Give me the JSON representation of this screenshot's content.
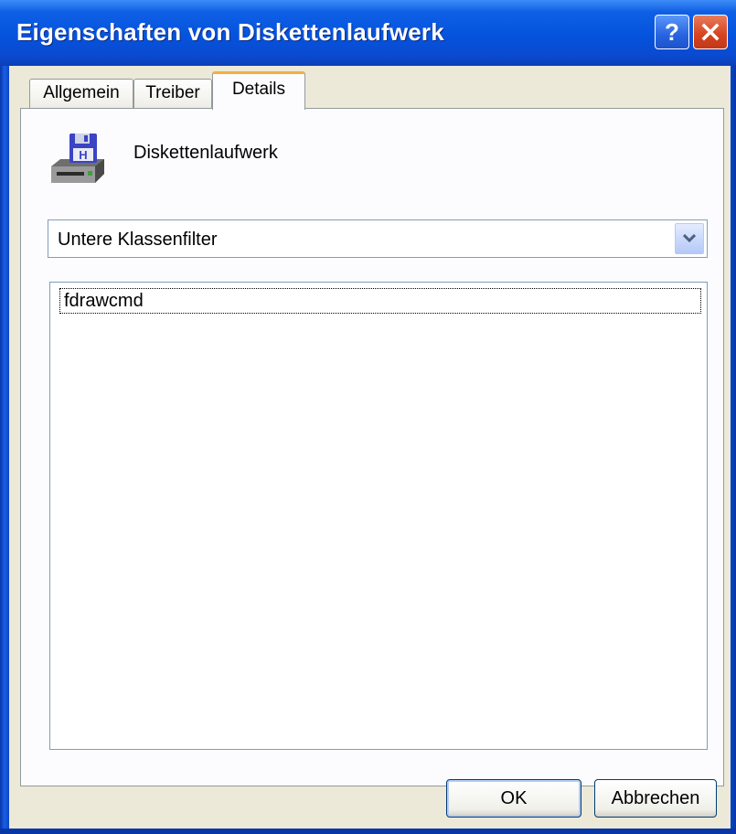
{
  "window": {
    "title": "Eigenschaften von Diskettenlaufwerk"
  },
  "tabs": [
    {
      "label": "Allgemein"
    },
    {
      "label": "Treiber"
    },
    {
      "label": "Details",
      "active": true
    }
  ],
  "device": {
    "icon": "floppy-drive-icon",
    "name": "Diskettenlaufwerk"
  },
  "property_select": {
    "value": "Untere Klassenfilter"
  },
  "values_list": {
    "items": [
      "fdrawcmd"
    ]
  },
  "buttons": {
    "ok": "OK",
    "cancel": "Abbrechen"
  },
  "colors": {
    "titlebar": "#0553dc",
    "dialog_bg": "#ece9d8",
    "active_tab_accent": "#f5ae3f",
    "close_button": "#d6421e"
  }
}
